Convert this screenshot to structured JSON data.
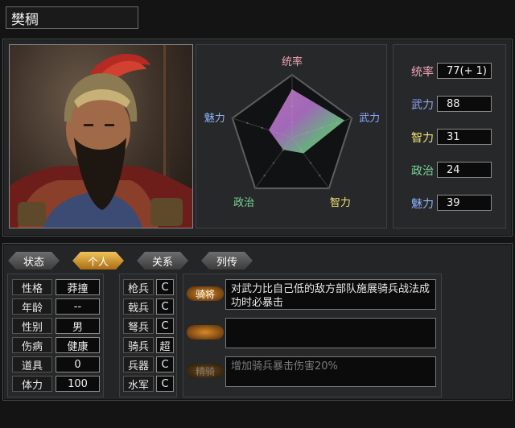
{
  "officer": {
    "name": "樊稠"
  },
  "radar": {
    "axis_labels": [
      "统率",
      "武力",
      "智力",
      "政治",
      "魅力"
    ],
    "values": [
      77,
      88,
      31,
      24,
      39
    ],
    "max": 100
  },
  "stats": [
    {
      "label": "统率",
      "value": "77(+ 1)",
      "color": "#f2a3b5"
    },
    {
      "label": "武力",
      "value": "88",
      "color": "#8fa6ff"
    },
    {
      "label": "智力",
      "value": "31",
      "color": "#f3e277"
    },
    {
      "label": "政治",
      "value": "24",
      "color": "#7fd39c"
    },
    {
      "label": "魅力",
      "value": "39",
      "color": "#8fb4ff"
    }
  ],
  "tabs": [
    {
      "label": "状态",
      "active": false
    },
    {
      "label": "个人",
      "active": true
    },
    {
      "label": "关系",
      "active": false
    },
    {
      "label": "列传",
      "active": false
    }
  ],
  "personal": [
    {
      "label": "性格",
      "value": "莽撞"
    },
    {
      "label": "年龄",
      "value": "--"
    },
    {
      "label": "性别",
      "value": "男"
    },
    {
      "label": "伤病",
      "value": "健康"
    },
    {
      "label": "道具",
      "value": "0"
    },
    {
      "label": "体力",
      "value": "100"
    }
  ],
  "aptitude": [
    {
      "label": "枪兵",
      "value": "C"
    },
    {
      "label": "戟兵",
      "value": "C"
    },
    {
      "label": "弩兵",
      "value": "C"
    },
    {
      "label": "骑兵",
      "value": "超"
    },
    {
      "label": "兵器",
      "value": "C"
    },
    {
      "label": "水军",
      "value": "C"
    }
  ],
  "skills": [
    {
      "badge": "骑将",
      "text": "对武力比自己低的敌方部队施展骑兵战法成功时必暴击",
      "active": true
    },
    {
      "badge": "",
      "text": "",
      "active": true
    },
    {
      "badge": "精骑",
      "text": "增加骑兵暴击伤害20%",
      "active": false
    }
  ]
}
